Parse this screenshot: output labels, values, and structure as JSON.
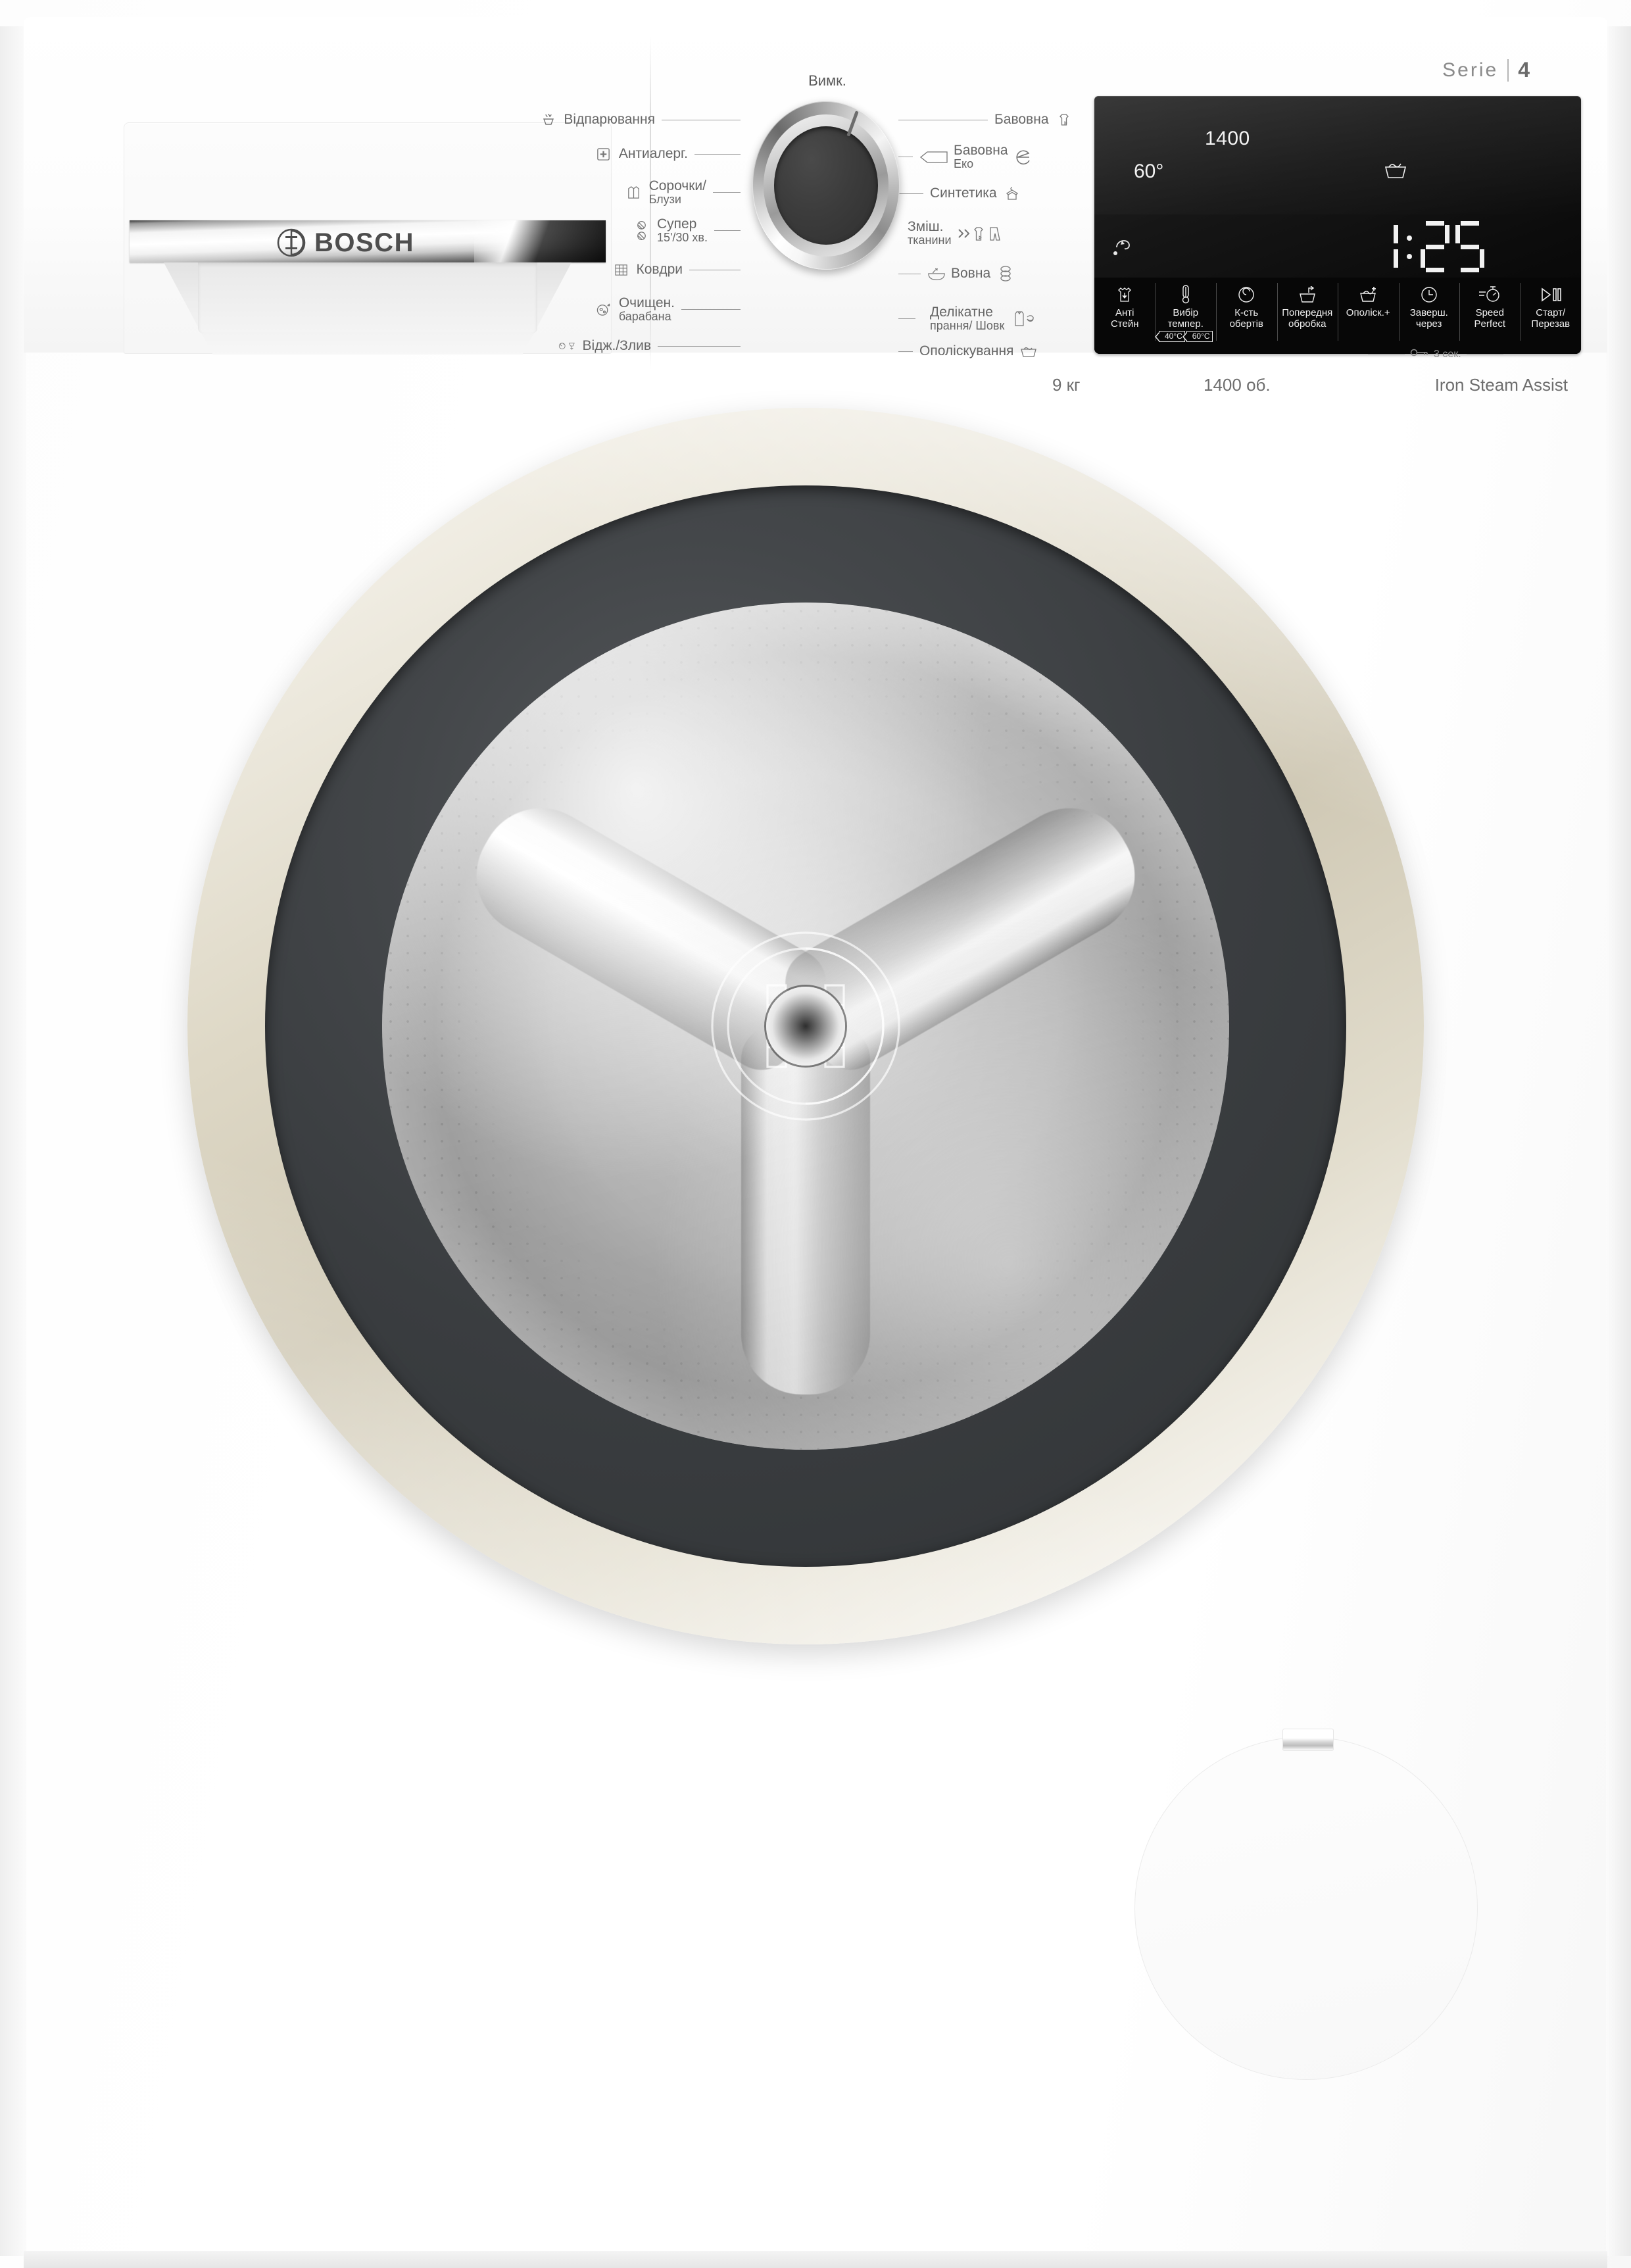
{
  "brand": {
    "logo_text": "BOSCH",
    "series_label": "Serie",
    "series_number": "4"
  },
  "selector": {
    "off_label": "Вимк.",
    "left_programs": [
      {
        "icon": "steam-icon",
        "line1": "Відпарювання",
        "line2": ""
      },
      {
        "icon": "allergy-plus-icon",
        "line1": "Антиалерг.",
        "line2": ""
      },
      {
        "icon": "shirt-icon",
        "line1": "Сорочки/",
        "line2": "Блузи"
      },
      {
        "icon": "quick-wash-icon",
        "line1": "Супер",
        "line2": "15'/30 хв."
      },
      {
        "icon": "duvet-icon",
        "line1": "Ковдри",
        "line2": ""
      },
      {
        "icon": "drum-clean-icon",
        "line1": "Очищен.",
        "line2": "барабана"
      },
      {
        "icon": "spin-drain-icon",
        "line1": "Відж./Злив",
        "line2": ""
      }
    ],
    "right_programs": [
      {
        "icon": "cotton-icon",
        "line1": "Бавовна",
        "line2": ""
      },
      {
        "icon": "cotton-eco-icon",
        "line1": "Бавовна",
        "line2": "Еко"
      },
      {
        "icon": "synthetics-icon",
        "line1": "Синтетика",
        "line2": ""
      },
      {
        "icon": "mixed-fabrics-icon",
        "line1": "Зміш.",
        "line2": "тканини"
      },
      {
        "icon": "wool-icon",
        "line1": "Вовна",
        "line2": ""
      },
      {
        "icon": "delicate-silk-icon",
        "line1": "Делікатне",
        "line2": "прання/ Шовк"
      },
      {
        "icon": "rinse-icon",
        "line1": "Ополіскування",
        "line2": ""
      }
    ]
  },
  "display": {
    "spin_speed": "1400",
    "temperature": "60°",
    "remaining_time": "1:25",
    "rinse_plus_icon": "rinse-basket-icon",
    "iron_steam_icon": "iron-steam-icon",
    "progress_bar_icon": "progress-dash-indicator"
  },
  "buttons": [
    {
      "icon": "anti-stain-shirt-icon",
      "label": "Анті\nСтейн",
      "chips": []
    },
    {
      "icon": "thermometer-icon",
      "label": "Вибір темпер.",
      "chips": [
        "40°C",
        "60°C"
      ]
    },
    {
      "icon": "spin-spiral-icon",
      "label": "К-сть\nобертів",
      "chips": []
    },
    {
      "icon": "prewash-icon",
      "label": "Попередня\nобробка",
      "chips": []
    },
    {
      "icon": "rinse-plus-icon",
      "label": "Ополіск.+",
      "chips": []
    },
    {
      "icon": "clock-icon",
      "label": "Заверш.\nчерез",
      "chips": []
    },
    {
      "icon": "speed-perfect-icon",
      "label": "Speed\nPerfect",
      "chips": []
    },
    {
      "icon": "start-pause-icon",
      "label": "Старт/\nПерезав",
      "chips": []
    }
  ],
  "child_lock_hint": {
    "icon": "key-icon",
    "text": "3 сек."
  },
  "specs": {
    "capacity": "9 кг",
    "spin": "1400 об.",
    "feature": "Iron Steam Assist"
  },
  "colors": {
    "door_ring": "#D6CFBC",
    "door_dark": "#3E4144",
    "panel_black": "#0B0B0B",
    "display_text": "#F2F2F2",
    "body_white": "#FFFFFF",
    "label_grey": "#666666"
  }
}
